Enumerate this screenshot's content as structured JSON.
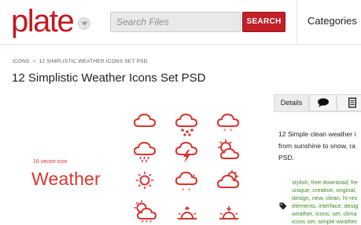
{
  "header": {
    "logo": "plate",
    "search_placeholder": "Search Files",
    "search_button": "SEARCH",
    "categories": "Categories"
  },
  "breadcrumb": {
    "items": [
      "ICONS",
      "12 SIMPLISTIC WEATHER ICONS SET PSD"
    ],
    "separator": ">"
  },
  "title": "12 Simplistic Weather Icons Set PSD",
  "preview": {
    "subtitle": "16 vector icon",
    "heading": "Weather",
    "accent_color": "#d8342f",
    "icons": [
      "cloud-icon",
      "cloud-hail-icon",
      "cloud-snow-icon",
      "cloud-rain-icon",
      "cloud-lightning-icon",
      "sun-cloud-icon",
      "sun-icon",
      "cloud-snow-sun-icon",
      "cloud-sun-behind-icon",
      "sun-cloud-rain-icon",
      "sunrise-icon",
      "sunset-icon"
    ]
  },
  "panel": {
    "tabs": [
      {
        "label": "Details",
        "icon": ""
      },
      {
        "label": "",
        "icon": "comment-icon"
      },
      {
        "label": "",
        "icon": "document-icon"
      }
    ],
    "description_lines": [
      "12 Simple clean weather i",
      "from sunshine to snow, ra",
      "PSD."
    ],
    "tag_lines": [
      "stylish, free download, fre",
      "unique, creative, original,",
      "design, new, clean, hi-res",
      "elements, interface, desig",
      "weather, icons, set, clima",
      "icons set, simple weather"
    ]
  },
  "colors": {
    "brand": "#c4181f",
    "tag_link": "#3f8c26"
  }
}
